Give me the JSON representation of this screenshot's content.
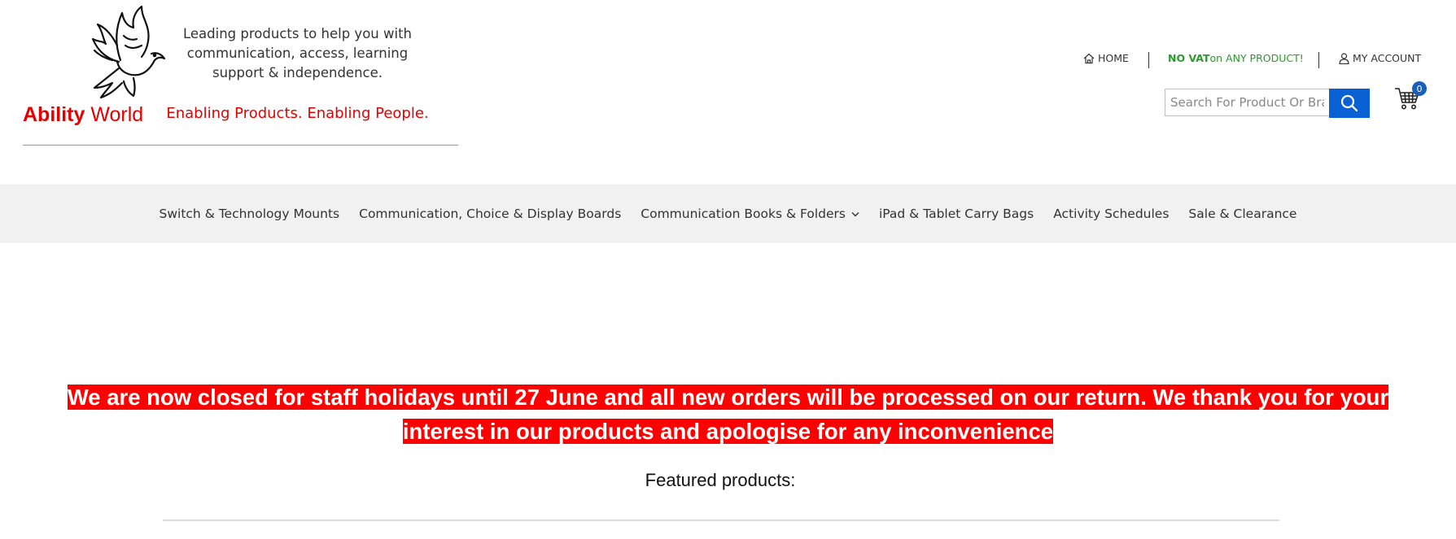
{
  "brand": {
    "logo_bold": "Ability",
    "logo_regular": " World",
    "tagline": "Leading products to help you with communication, access, learning support & independence.",
    "slogan": "Enabling Products. Enabling People."
  },
  "top_links": {
    "home": "HOME",
    "vat_bold": "NO VAT",
    "vat_rest": " on ANY PRODUCT!",
    "account": "MY ACCOUNT"
  },
  "search": {
    "placeholder": "Search For Product Or Brand",
    "value": ""
  },
  "cart": {
    "count": "0"
  },
  "nav": {
    "items": [
      {
        "label": "Switch & Technology Mounts"
      },
      {
        "label": "Communication, Choice & Display Boards"
      },
      {
        "label": "Communication Books & Folders"
      },
      {
        "label": "iPad & Tablet Carry Bags"
      },
      {
        "label": "Activity Schedules"
      },
      {
        "label": "Sale & Clearance"
      }
    ]
  },
  "notice": {
    "text": "We are now closed for staff holidays until 27 June and all new orders will be processed on our return. We thank you for your interest in our products and apologise for any inconvenience "
  },
  "featured": {
    "heading": "Featured products:"
  },
  "colors": {
    "brand_red": "#e30000",
    "vat_green": "#2a9a2a",
    "accent_blue": "#0a61d4",
    "notice_bg": "#ff0000",
    "nav_bg": "#f1f1f1"
  },
  "icons": {
    "logo": "dove-icon",
    "home": "home-icon",
    "account": "user-icon",
    "search": "search-icon",
    "cart": "cart-icon",
    "dropdown": "chevron-down-icon"
  }
}
